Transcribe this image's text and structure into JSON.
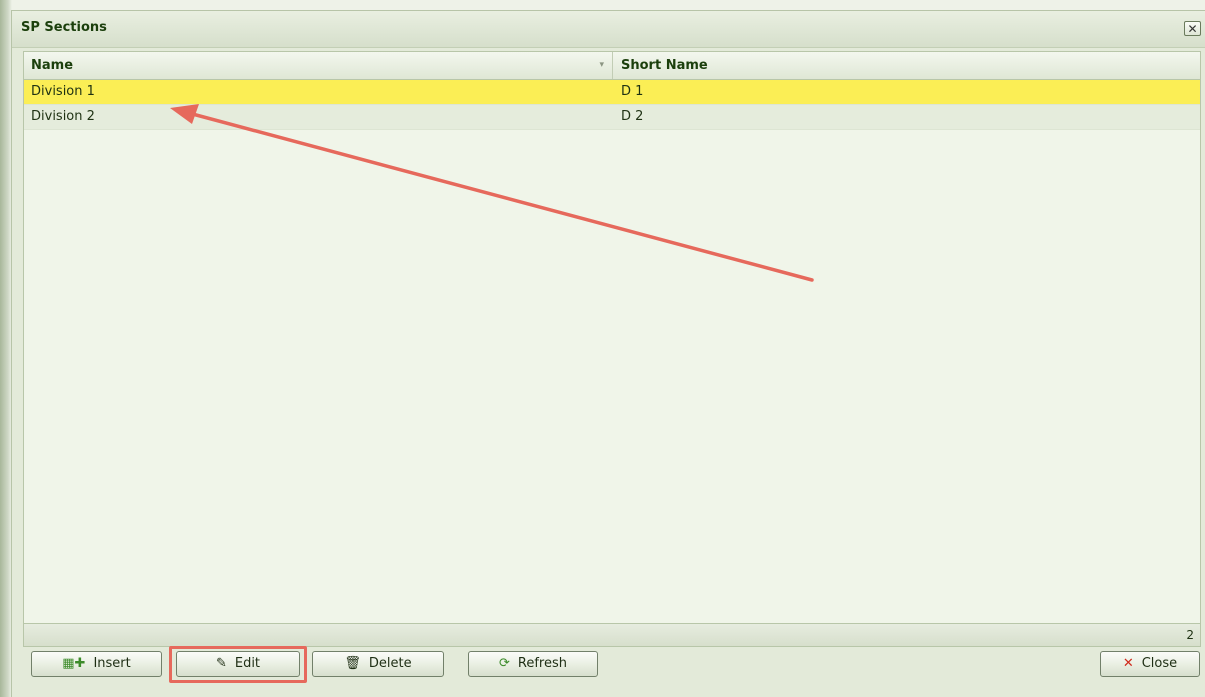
{
  "window": {
    "title": "SP Sections",
    "close_icon": "✕"
  },
  "grid": {
    "columns": [
      "Name",
      "Short Name"
    ],
    "sort_icon": "▾",
    "rows": [
      {
        "name": "Division 1",
        "short": "D 1",
        "selected": true
      },
      {
        "name": "Division 2",
        "short": "D 2",
        "selected": false
      }
    ],
    "record_count": "2"
  },
  "toolbar": {
    "insert_label": "Insert",
    "edit_label": "Edit",
    "delete_label": "Delete",
    "refresh_label": "Refresh",
    "close_label": "Close"
  },
  "icons": {
    "insert": "insert-icon",
    "edit": "pencil-icon",
    "delete": "trash-icon",
    "refresh": "refresh-icon",
    "close": "close-icon"
  },
  "colors": {
    "selected_row": "#fbee55",
    "annotation": "#e6695c",
    "title": "#1b3f0c"
  }
}
